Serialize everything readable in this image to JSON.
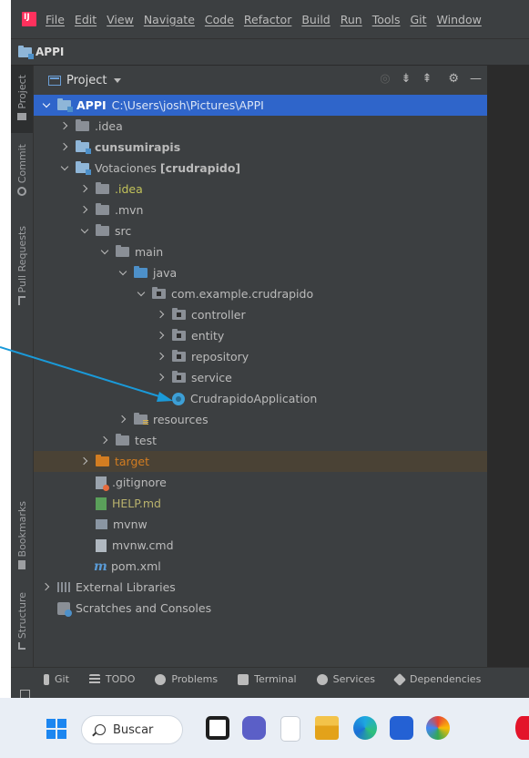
{
  "menu": [
    "File",
    "Edit",
    "View",
    "Navigate",
    "Code",
    "Refactor",
    "Build",
    "Run",
    "Tools",
    "Git",
    "Window"
  ],
  "navbar": {
    "project": "APPI"
  },
  "left_strip": {
    "tabs": [
      "Project",
      "Commit",
      "Pull Requests",
      "Bookmarks",
      "Structure"
    ]
  },
  "panel": {
    "title": "Project"
  },
  "tree": [
    {
      "label": "APPI",
      "path": "C:\\Users\\josh\\Pictures\\APPI"
    },
    {
      "label": ".idea"
    },
    {
      "label": "cunsumirapis"
    },
    {
      "label": "Votaciones",
      "suffix": "[crudrapido]"
    },
    {
      "label": ".idea"
    },
    {
      "label": ".mvn"
    },
    {
      "label": "src"
    },
    {
      "label": "main"
    },
    {
      "label": "java"
    },
    {
      "label": "com.example.crudrapido"
    },
    {
      "label": "controller"
    },
    {
      "label": "entity"
    },
    {
      "label": "repository"
    },
    {
      "label": "service"
    },
    {
      "label": "CrudrapidoApplication"
    },
    {
      "label": "resources"
    },
    {
      "label": "test"
    },
    {
      "label": "target"
    },
    {
      "label": ".gitignore"
    },
    {
      "label": "HELP.md"
    },
    {
      "label": "mvnw"
    },
    {
      "label": "mvnw.cmd"
    },
    {
      "label": "pom.xml"
    },
    {
      "label": "External Libraries"
    },
    {
      "label": "Scratches and Consoles"
    }
  ],
  "bottom_tools": [
    "Git",
    "TODO",
    "Problems",
    "Terminal",
    "Services",
    "Dependencies"
  ],
  "taskbar": {
    "search_label": "Buscar"
  },
  "colors": {
    "selection": "#2f65ca",
    "arrow": "#1a9ad9",
    "excluded": "#d37d21"
  }
}
